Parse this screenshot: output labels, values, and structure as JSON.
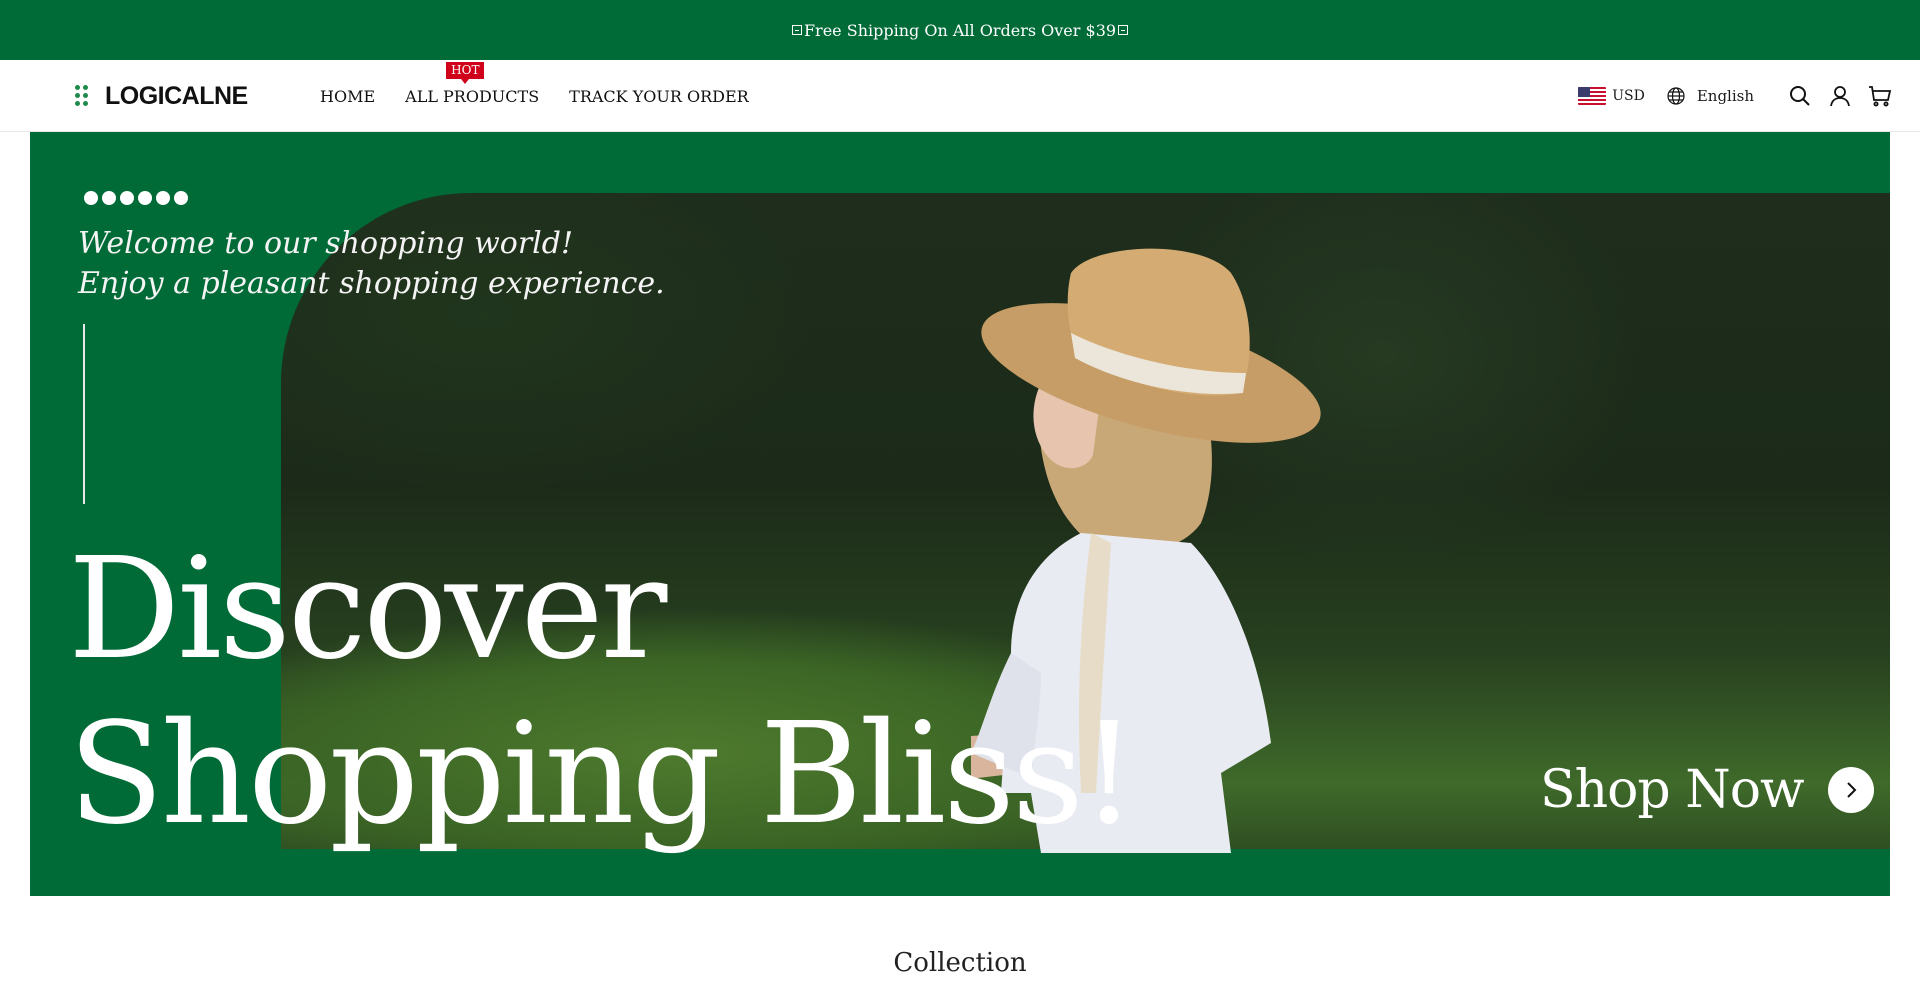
{
  "announcement": {
    "text": "Free Shipping On All Orders Over $39"
  },
  "header": {
    "logo_text": "LOGICALNE",
    "nav": [
      {
        "label": "HOME"
      },
      {
        "label": "ALL PRODUCTS",
        "badge": "HOT"
      },
      {
        "label": "TRACK YOUR ORDER"
      }
    ],
    "currency": "USD",
    "language": "English",
    "icons": [
      "globe-icon",
      "search-icon",
      "account-icon",
      "cart-icon"
    ]
  },
  "hero": {
    "slide_count": 6,
    "welcome_line1": "Welcome to our shopping world!",
    "welcome_line2": "Enjoy a pleasant shopping experience.",
    "headline_line1": "Discover",
    "headline_line2": "Shopping Bliss!",
    "cta_label": "Shop Now"
  },
  "section": {
    "title": "Collection"
  },
  "colors": {
    "brand_green": "#006b37",
    "badge_red": "#d0021b",
    "white": "#ffffff"
  }
}
